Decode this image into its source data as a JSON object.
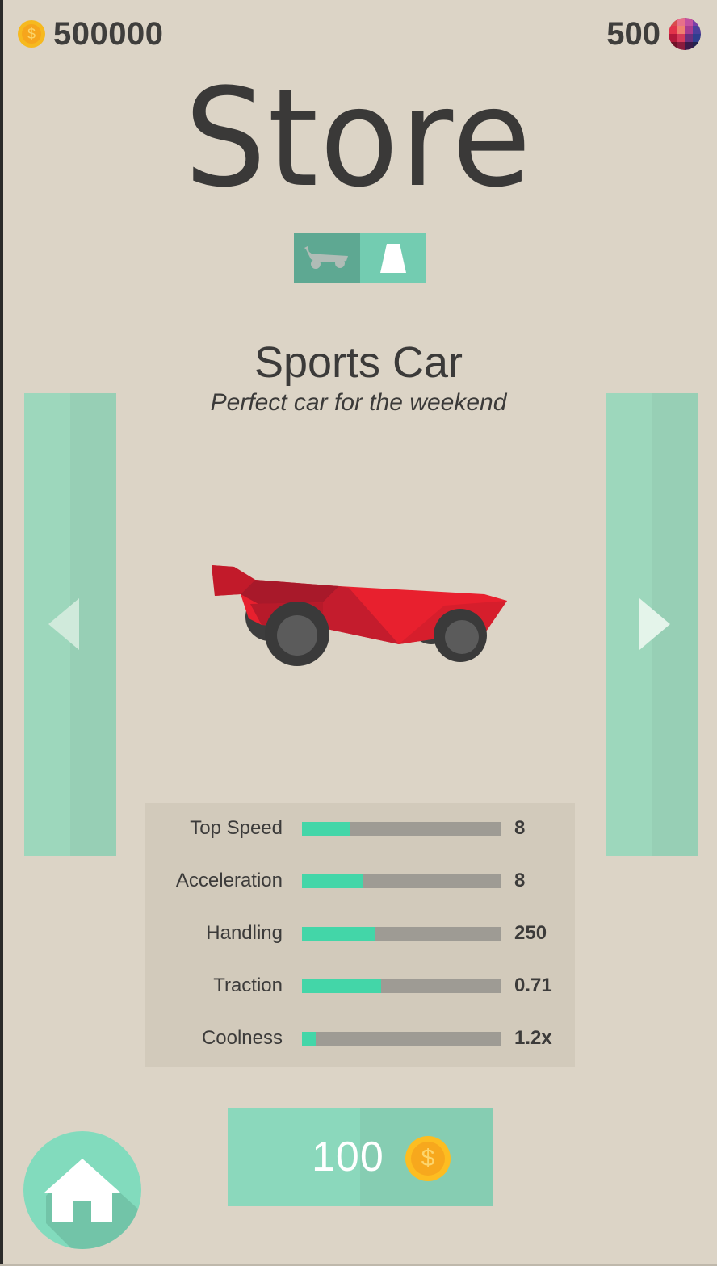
{
  "header": {
    "coins": "500000",
    "coin_symbol": "$",
    "gems": "500"
  },
  "page_title": "Store",
  "tabs": [
    {
      "name": "cars",
      "icon": "car-silhouette-icon",
      "active": true
    },
    {
      "name": "roads",
      "icon": "road-icon",
      "active": false
    }
  ],
  "item": {
    "name": "Sports Car",
    "description": "Perfect car for the weekend",
    "color": "#e8202e"
  },
  "stats": [
    {
      "label": "Top Speed",
      "value": "8",
      "fill": 0.24
    },
    {
      "label": "Acceleration",
      "value": "8",
      "fill": 0.31
    },
    {
      "label": "Handling",
      "value": "250",
      "fill": 0.37
    },
    {
      "label": "Traction",
      "value": "0.71",
      "fill": 0.4
    },
    {
      "label": "Coolness",
      "value": "1.2x",
      "fill": 0.07
    }
  ],
  "buy": {
    "price": "100",
    "coin_symbol": "$"
  },
  "colors": {
    "background": "#dcd4c6",
    "accent": "#43d6a8",
    "nav_panel": "#9dd7bc",
    "coin": "#f6b91f"
  }
}
